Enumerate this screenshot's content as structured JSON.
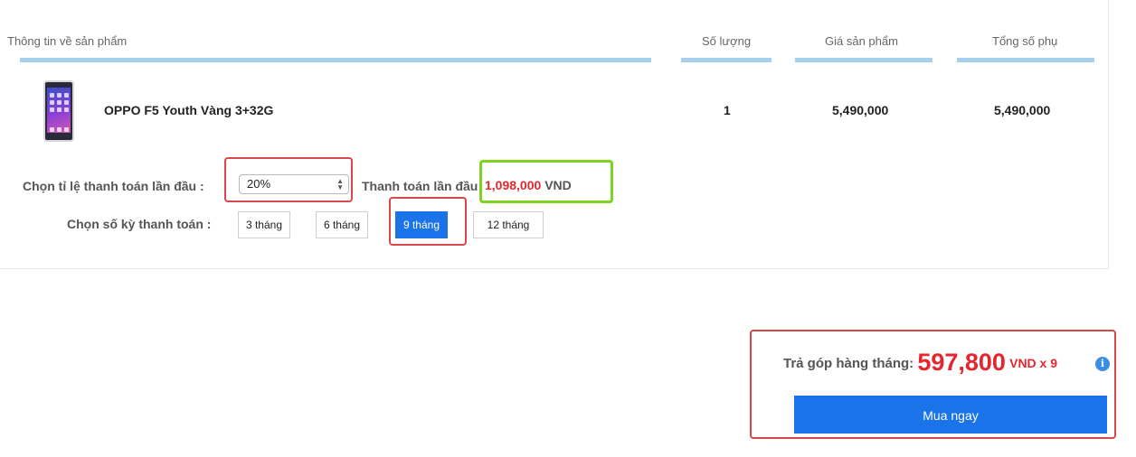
{
  "table": {
    "headers": {
      "product_info": "Thông tin về sản phẩm",
      "quantity": "Số lượng",
      "price": "Giá sản phẩm",
      "total": "Tổng số phụ"
    },
    "row": {
      "product_name": "OPPO F5 Youth Vàng 3+32G",
      "quantity": "1",
      "price": "5,490,000",
      "subtotal": "5,490,000"
    }
  },
  "installment": {
    "down_payment_label": "Chọn tỉ lệ thanh toán lần đầu :",
    "down_payment_selected": "20%",
    "first_payment_label": "Thanh toán lần đầu",
    "first_payment_amount": "1,098,000",
    "first_payment_currency": "VND",
    "terms_label": "Chọn số kỳ thanh toán :",
    "terms": [
      "3 tháng",
      "6 tháng",
      "9 tháng",
      "12 tháng"
    ],
    "selected_term": "9 tháng"
  },
  "summary": {
    "monthly_label": "Trả góp hàng tháng:",
    "monthly_amount": "597,800",
    "monthly_suffix": "VND x 9",
    "info_icon": "i",
    "buy_label": "Mua ngay"
  },
  "colors": {
    "accent": "#1a73e8",
    "price_red": "#e4262f",
    "header_bar": "#a7d0ee",
    "highlight_red": "#d9474b",
    "highlight_green": "#7ed321"
  }
}
